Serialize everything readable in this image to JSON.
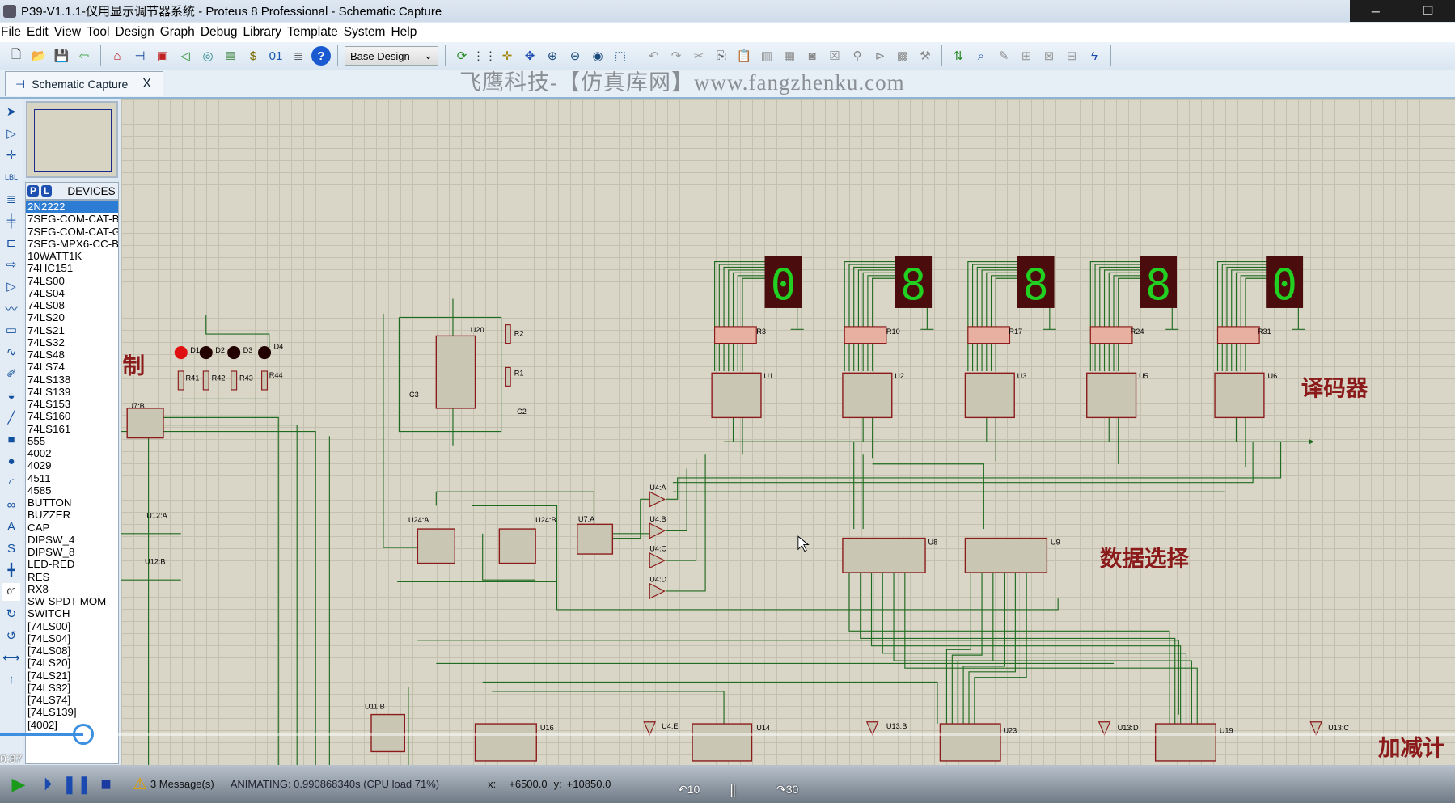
{
  "window": {
    "title": "P39-V1.1.1-仪用显示调节器系统 - Proteus 8 Professional - Schematic Capture",
    "minimize": "─",
    "restore": "❐"
  },
  "menu": [
    "File",
    "Edit",
    "View",
    "Tool",
    "Design",
    "Graph",
    "Debug",
    "Library",
    "Template",
    "System",
    "Help"
  ],
  "toolbar": {
    "group1": [
      {
        "icon": "new-file-icon",
        "glyph": "🗋",
        "color": "#333"
      },
      {
        "icon": "open-folder-icon",
        "glyph": "📂",
        "color": "#d79a1e"
      },
      {
        "icon": "save-icon",
        "glyph": "💾",
        "color": "#2a6ab8"
      },
      {
        "icon": "exit-icon",
        "glyph": "⇦",
        "color": "#2a9a2a"
      }
    ],
    "group2": [
      {
        "icon": "home-icon",
        "glyph": "⌂",
        "color": "#c02020"
      },
      {
        "icon": "schematic-icon",
        "glyph": "⊣",
        "color": "#1a4a9a"
      },
      {
        "icon": "pcb-icon",
        "glyph": "▣",
        "color": "#c02020"
      },
      {
        "icon": "gerber-icon",
        "glyph": "◁",
        "color": "#2a8a2a"
      },
      {
        "icon": "3d-viewer-icon",
        "glyph": "◎",
        "color": "#2a8a8a"
      },
      {
        "icon": "bom-icon",
        "glyph": "▤",
        "color": "#2a7a2a"
      },
      {
        "icon": "cost-icon",
        "glyph": "$",
        "color": "#7a6a00"
      },
      {
        "icon": "source-code-icon",
        "glyph": "01",
        "color": "#1a5ab0"
      },
      {
        "icon": "notes-icon",
        "glyph": "≣",
        "color": "#555"
      },
      {
        "icon": "help-icon",
        "glyph": "?",
        "color": "#fff"
      }
    ],
    "design_select": "Base Design",
    "group3": [
      {
        "icon": "refresh-icon",
        "glyph": "⟳",
        "color": "#2a8a2a"
      },
      {
        "icon": "grid-icon",
        "glyph": "⋮⋮",
        "color": "#333"
      },
      {
        "icon": "origin-icon",
        "glyph": "✛",
        "color": "#a08000"
      },
      {
        "icon": "pan-icon",
        "glyph": "✥",
        "color": "#1a4ab0"
      },
      {
        "icon": "zoom-in-icon",
        "glyph": "⊕",
        "color": "#1a4a7a"
      },
      {
        "icon": "zoom-out-icon",
        "glyph": "⊖",
        "color": "#1a4a7a"
      },
      {
        "icon": "zoom-all-icon",
        "glyph": "◉",
        "color": "#1a4a7a"
      },
      {
        "icon": "zoom-area-icon",
        "glyph": "⬚",
        "color": "#1a4a7a"
      }
    ],
    "group4": [
      {
        "icon": "undo-icon",
        "glyph": "↶",
        "color": "#999"
      },
      {
        "icon": "redo-icon",
        "glyph": "↷",
        "color": "#999"
      },
      {
        "icon": "cut-icon",
        "glyph": "✂",
        "color": "#999"
      },
      {
        "icon": "copy-icon",
        "glyph": "⎘",
        "color": "#555"
      },
      {
        "icon": "paste-icon",
        "glyph": "📋",
        "color": "#999"
      },
      {
        "icon": "block-copy-icon",
        "glyph": "▥",
        "color": "#888"
      },
      {
        "icon": "block-move-icon",
        "glyph": "▦",
        "color": "#888"
      },
      {
        "icon": "block-rotate-icon",
        "glyph": "◙",
        "color": "#888"
      },
      {
        "icon": "block-delete-icon",
        "glyph": "☒",
        "color": "#888"
      },
      {
        "icon": "pick-device-icon",
        "glyph": "⚲",
        "color": "#888"
      },
      {
        "icon": "make-device-icon",
        "glyph": "⊳",
        "color": "#888"
      },
      {
        "icon": "package-tool-icon",
        "glyph": "▩",
        "color": "#888"
      },
      {
        "icon": "decompose-icon",
        "glyph": "⚒",
        "color": "#888"
      }
    ],
    "group5": [
      {
        "icon": "wire-autorouter-icon",
        "glyph": "⇅",
        "color": "#2a8a2a"
      },
      {
        "icon": "search-icon",
        "glyph": "⌕",
        "color": "#1a4ab0"
      },
      {
        "icon": "property-tool-icon",
        "glyph": "✎",
        "color": "#888"
      },
      {
        "icon": "new-sheet-icon",
        "glyph": "⊞",
        "color": "#999"
      },
      {
        "icon": "remove-sheet-icon",
        "glyph": "⊠",
        "color": "#999"
      },
      {
        "icon": "exit-to-parent-icon",
        "glyph": "⊟",
        "color": "#999"
      },
      {
        "icon": "electrical-rules-icon",
        "glyph": "ϟ",
        "color": "#1a4ab0"
      }
    ]
  },
  "tab": {
    "label": "Schematic Capture",
    "close": "X"
  },
  "watermark": "飞鹰科技-【仿真库网】www.fangzhenku.com",
  "left_tools": [
    {
      "icon": "select-arrow-icon",
      "glyph": "➤"
    },
    {
      "icon": "component-icon",
      "glyph": "▷"
    },
    {
      "icon": "junction-icon",
      "glyph": "✛"
    },
    {
      "icon": "wire-label-icon",
      "glyph": "LBL"
    },
    {
      "icon": "text-script-icon",
      "glyph": "≣"
    },
    {
      "icon": "bus-icon",
      "glyph": "╪"
    },
    {
      "icon": "subcircuit-icon",
      "glyph": "⊏"
    },
    {
      "icon": "terminal-icon",
      "glyph": "⇨"
    },
    {
      "icon": "device-pin-icon",
      "glyph": "▷"
    },
    {
      "icon": "graph-icon",
      "glyph": "〰"
    },
    {
      "icon": "tape-recorder-icon",
      "glyph": "▭"
    },
    {
      "icon": "generator-icon",
      "glyph": "∿"
    },
    {
      "icon": "voltage-probe-icon",
      "glyph": "✐"
    },
    {
      "icon": "virtual-instrument-icon",
      "glyph": "◒"
    },
    {
      "icon": "line-icon",
      "glyph": "╱"
    },
    {
      "icon": "box-icon",
      "glyph": "■"
    },
    {
      "icon": "circle-icon",
      "glyph": "●"
    },
    {
      "icon": "arc-icon",
      "glyph": "◜"
    },
    {
      "icon": "path-icon",
      "glyph": "∞"
    },
    {
      "icon": "text-icon",
      "glyph": "A"
    },
    {
      "icon": "symbol-icon",
      "glyph": "S"
    },
    {
      "icon": "marker-icon",
      "glyph": "╋"
    },
    {
      "icon": "rotate-cw-icon",
      "glyph": "↻"
    },
    {
      "icon": "rotate-ccw-icon",
      "glyph": "↺"
    },
    {
      "icon": "mirror-x-icon",
      "glyph": "⟷"
    },
    {
      "icon": "mirror-y-icon",
      "glyph": "↑"
    }
  ],
  "rotation_value": "0°",
  "devices": {
    "p": "P",
    "l": "L",
    "header": "DEVICES",
    "selected": "2N2222",
    "items": [
      "2N2222",
      "7SEG-COM-CAT-B",
      "7SEG-COM-CAT-G",
      "7SEG-MPX6-CC-BL",
      "10WATT1K",
      "74HC151",
      "74LS00",
      "74LS04",
      "74LS08",
      "74LS20",
      "74LS21",
      "74LS32",
      "74LS48",
      "74LS74",
      "74LS138",
      "74LS139",
      "74LS153",
      "74LS160",
      "74LS161",
      "555",
      "4002",
      "4029",
      "4511",
      "4585",
      "BUTTON",
      "BUZZER",
      "CAP",
      "DIPSW_4",
      "DIPSW_8",
      "LED-RED",
      "RES",
      "RX8",
      "SW-SPDT-MOM",
      "SWITCH",
      "[74LS00]",
      "[74LS04]",
      "[74LS08]",
      "[74LS20]",
      "[74LS21]",
      "[74LS32]",
      "[74LS74]",
      "[74LS139]",
      "[4002]"
    ]
  },
  "schematic": {
    "displays": [
      "0",
      "8",
      "8",
      "8",
      "0"
    ],
    "labels": [
      "R3",
      "R10",
      "R17",
      "R24",
      "R31",
      "U1",
      "U2",
      "U3",
      "U5",
      "U6",
      "U8",
      "U9",
      "U20",
      "R2",
      "R1",
      "C3",
      "C2",
      "U24:A",
      "U24:B",
      "U7:A",
      "U4:A",
      "U4:B",
      "U4:C",
      "U4:D",
      "U12:A",
      "U12:B",
      "U7:B",
      "D1",
      "D2",
      "D3",
      "D4",
      "R41",
      "R42",
      "R43",
      "R44",
      "U11:B",
      "U16",
      "U4:E",
      "U14",
      "U13:B",
      "U23",
      "U13:D",
      "U19",
      "U13:C"
    ],
    "section_labels": [
      "制",
      "译码器",
      "数据选择",
      "加减计"
    ],
    "colors": {
      "wire": "#1f6b1f",
      "part": "#8b1a1a",
      "part_fill": "#c9c6b4",
      "display_bg": "#4a0c0c",
      "segment_on": "#22d022",
      "label": "#8b1a1a"
    }
  },
  "status": {
    "messages": "3 Message(s)",
    "animating": "ANIMATING: 0.990868340s (CPU load 71%)",
    "x_label": "x:",
    "x_value": "+6500.0",
    "y_label": "y:",
    "y_value": "+10850.0"
  },
  "video": {
    "time": "0:37",
    "rewind": "10",
    "forward": "30",
    "progress_percent": 6
  }
}
